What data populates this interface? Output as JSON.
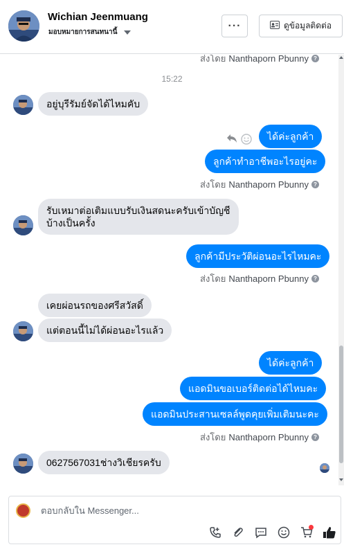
{
  "header": {
    "contact_name": "Wichian Jeenmuang",
    "assignment": "มอบหมายการสนทนานี้",
    "more_label": "···",
    "contact_info_label": "ดูข้อมูลติดต่อ"
  },
  "thread": {
    "sent_by_prefix": "ส่งโดย",
    "sender_name": "Nanthaporn Pbunny",
    "help_glyph": "?",
    "timestamp": "15:22",
    "messages": {
      "m1": "อยู่บุรีรัมย์จัดได้ไหมคับ",
      "m2": "ได้ค่ะลูกค้า",
      "m3": "ลูกค้าทำอาชีพอะไรอยู่คะ",
      "m4_line1": "รับเหมาต่อเติมแบบรับเงินสดนะครับเข้าบัญชี",
      "m4_line2": "บ้างเป็นครั้ง",
      "m5": "ลูกค้ามีประวัติผ่อนอะไรไหมคะ",
      "m6": "เคยผ่อนรถของศรีสวัสดิ์",
      "m7": "แต่ตอนนี้ไม่ได้ผ่อนอะไรแล้ว",
      "m8": "ได้ค่ะลูกค้า",
      "m9": "แอดมินขอเบอร์ติดต่อได้ไหมคะ",
      "m10": "แอดมินประสานเซลล์พูดคุยเพิ่มเติมนะคะ",
      "m11": "0627567031ช่างวิเชียรครับ"
    }
  },
  "composer": {
    "placeholder": "ตอบกลับใน Messenger..."
  },
  "colors": {
    "outgoing_bubble": "#0084ff",
    "incoming_bubble": "#e4e6eb",
    "brand_accent": "#1877f2"
  },
  "icons": [
    "reply-icon",
    "emoji-react-icon",
    "call-icon",
    "attach-icon",
    "saved-reply-icon",
    "emoji-icon",
    "cart-icon",
    "like-icon",
    "help-icon",
    "contact-card-icon"
  ]
}
